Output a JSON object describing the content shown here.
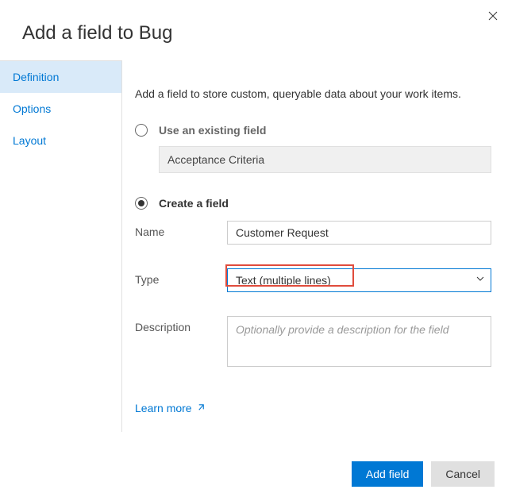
{
  "dialog": {
    "title": "Add a field to Bug"
  },
  "sidebar": {
    "items": [
      {
        "label": "Definition",
        "active": true
      },
      {
        "label": "Options",
        "active": false
      },
      {
        "label": "Layout",
        "active": false
      }
    ]
  },
  "content": {
    "description": "Add a field to store custom, queryable data about your work items.",
    "existing_option_label": "Use an existing field",
    "existing_field_value": "Acceptance Criteria",
    "create_option_label": "Create a field",
    "name_label": "Name",
    "name_value": "Customer Request",
    "type_label": "Type",
    "type_value": "Text (multiple lines)",
    "description_label": "Description",
    "description_placeholder": "Optionally provide a description for the field",
    "learn_more": "Learn more"
  },
  "footer": {
    "primary": "Add field",
    "secondary": "Cancel"
  }
}
